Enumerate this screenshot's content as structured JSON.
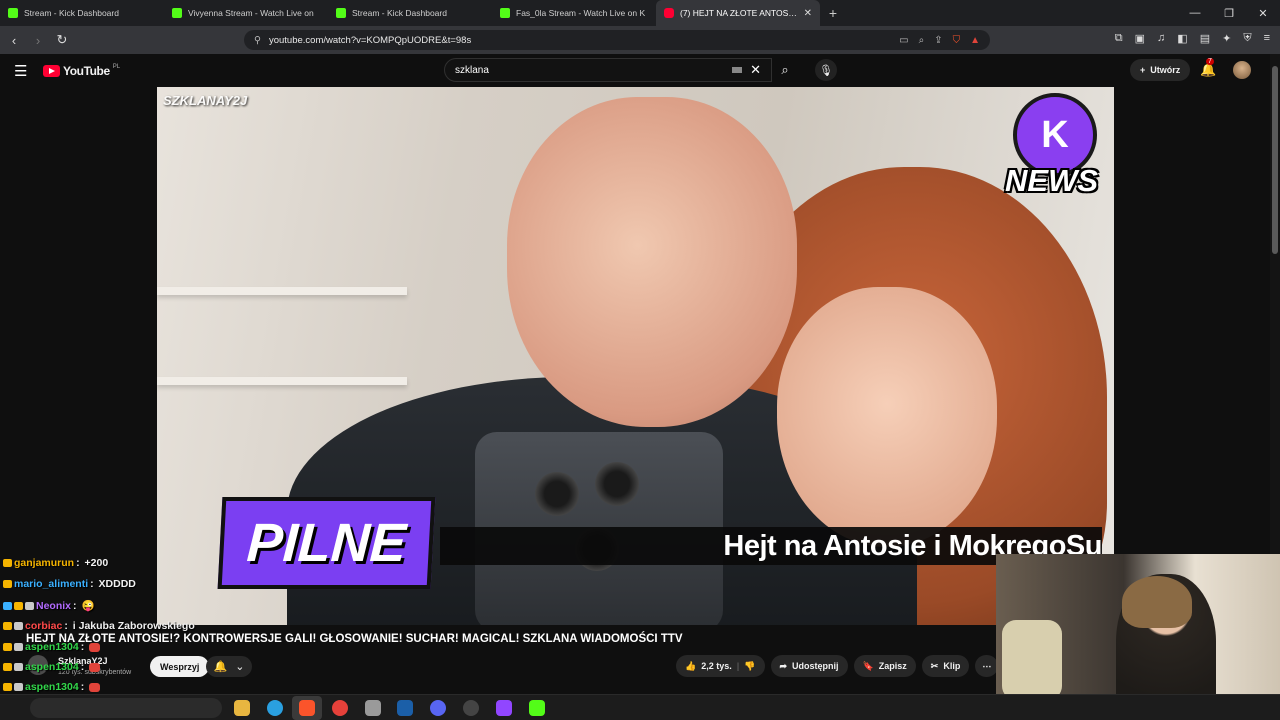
{
  "browser": {
    "tabs": [
      {
        "title": "Stream - Kick Dashboard",
        "favicon": "kick-icon",
        "active": false
      },
      {
        "title": "Vivyenna Stream - Watch Live on",
        "favicon": "kick-icon",
        "active": false
      },
      {
        "title": "Stream - Kick Dashboard",
        "favicon": "kick-icon",
        "active": false
      },
      {
        "title": "Fas_0la Stream - Watch Live on K",
        "favicon": "kick-icon",
        "active": false
      },
      {
        "title": "(7) HEJT NA ZŁOTE ANTOSIE!",
        "favicon": "youtube-icon",
        "active": true
      }
    ],
    "url": "youtube.com/watch?v=KOMPQpUODRE&t=98s"
  },
  "youtube": {
    "logo_text": "YouTube",
    "country_code": "PL",
    "search_value": "szklana",
    "create_label": "Utwórz",
    "notification_count": "7",
    "video": {
      "watermark": "SZKLANAY2J",
      "news_logo": "NEWS",
      "pilne_label": "PILNE",
      "ticker_text": "Hejt na Antosie i MokregoSu"
    },
    "title": "HEJT NA ZŁOTE ANTOSIE!? KONTROWERSJE GALI! GŁOSOWANIE! SUCHAR! MAGICAL! SZKLANA WIADOMOŚCI TTV",
    "channel": {
      "name": "SzklanaY2J",
      "subscribers": "120 tys. subskrybentów"
    },
    "support_label": "Wesprzyj",
    "likes": "2,2 tys.",
    "share_label": "Udostępnij",
    "save_label": "Zapisz",
    "clip_label": "Klip"
  },
  "chat": [
    {
      "user": "ganjamurun",
      "message": "+200",
      "color": "#f5b400"
    },
    {
      "user": "mario_alimenti",
      "message": "XDDDD",
      "color": "#3ab0ff"
    },
    {
      "user": "Neonix",
      "message": "😜",
      "color": "#b36bff"
    },
    {
      "user": "corbiac",
      "message": "i Jakuba Zaborowskiego",
      "color": "#ff4a4a"
    },
    {
      "user": "aspen1304",
      "message": "",
      "color": "#32d64a"
    },
    {
      "user": "aspen1304",
      "message": "",
      "color": "#32d64a"
    },
    {
      "user": "aspen1304",
      "message": "",
      "color": "#32d64a"
    },
    {
      "user": "aspen1304",
      "message": "",
      "color": "#32d64a"
    }
  ],
  "colors": {
    "accent": "#ff0033",
    "kick": "#53fc18",
    "pilne": "#7b3ff2"
  }
}
